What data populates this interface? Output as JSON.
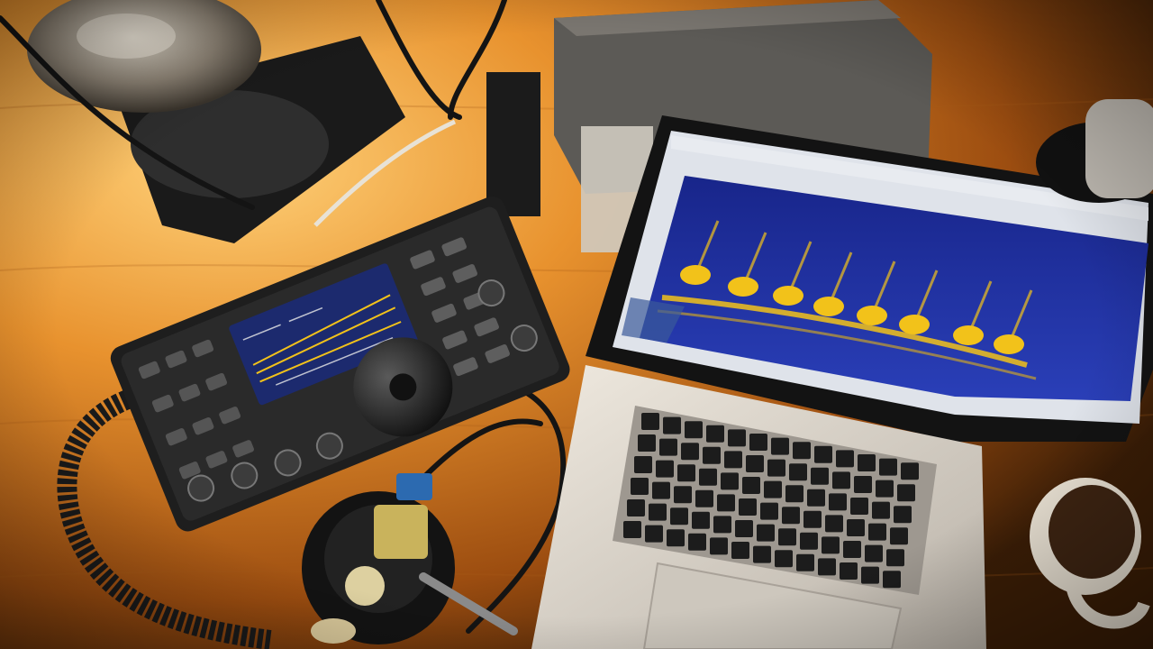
{
  "scene": {
    "description_free": true,
    "colors": {
      "desk_light": "#f0a040",
      "desk_mid": "#c46a18",
      "desk_dark": "#3a1d06",
      "radio_body": "#1e1e1e",
      "radio_panel": "#2c2c2c",
      "radio_screen_bg": "#1c2a6e",
      "signal_yellow": "#f2c21a",
      "waterfall_blue": "#1a2c9a",
      "laptop_silver": "#d6d2cc",
      "keyboard_key": "#1c1c1c",
      "lamp_metal": "#9a8f80",
      "cable_dark": "#141414",
      "mug_white": "#ece6dc"
    },
    "objects": [
      {
        "name": "desk-lamp",
        "icon": "lamp-icon"
      },
      {
        "name": "ham-radio-transceiver",
        "icon": "radio-icon"
      },
      {
        "name": "laptop-computer",
        "icon": "laptop-icon"
      },
      {
        "name": "spectrum-waterfall-display",
        "icon": "waterfall-icon"
      },
      {
        "name": "coiled-microphone-cable",
        "icon": "cable-icon"
      },
      {
        "name": "morse-key-microphone-base",
        "icon": "microphone-icon"
      },
      {
        "name": "coffee-mug",
        "icon": "mug-icon"
      },
      {
        "name": "power-supply-box",
        "icon": "box-icon"
      }
    ]
  }
}
